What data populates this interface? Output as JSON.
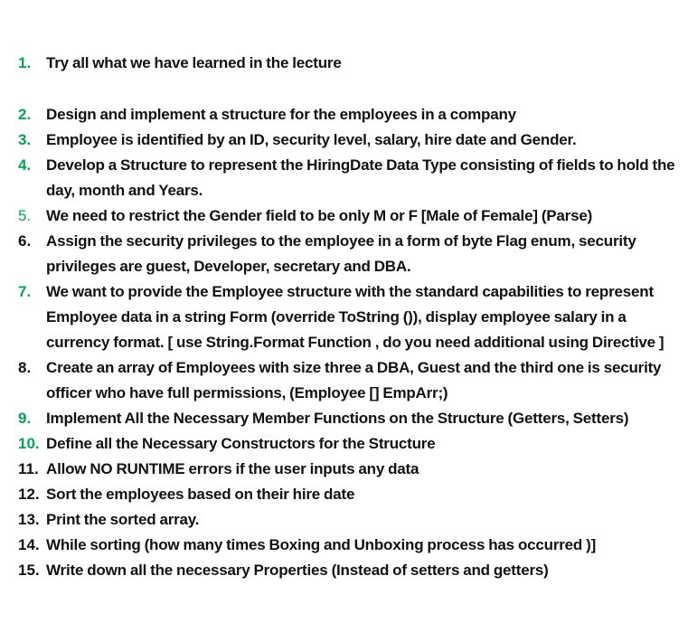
{
  "items": [
    {
      "number": "1.",
      "text": "Try all what we have learned in the lecture"
    },
    {
      "number": "2.",
      "text": "Design and implement a structure for the employees in a company"
    },
    {
      "number": "3.",
      "text": "Employee is identified by an ID, security level, salary, hire date and Gender."
    },
    {
      "number": "4.",
      "text": "Develop a Structure to represent the HiringDate Data Type consisting of fields to hold the day, month and Years."
    },
    {
      "number": "5.",
      "text": "We need to restrict the Gender field to be only M or F [Male of Female] (Parse)"
    },
    {
      "number": "6.",
      "text": "Assign the security privileges to the employee in a form of byte Flag enum, security privileges are guest, Developer, secretary and DBA."
    },
    {
      "number": "7.",
      "text": "We want to provide the Employee structure with the standard capabilities to represent Employee data in a string Form (override ToString ()), display employee salary in a currency format. [ use String.Format Function , do you need additional using Directive ]"
    },
    {
      "number": "8.",
      "text": "Create an array of Employees with size three a DBA, Guest and the third one is security officer who have full permissions, (Employee [] EmpArr;)"
    },
    {
      "number": "9.",
      "text": " Implement All the Necessary Member Functions on the Structure (Getters, Setters)"
    },
    {
      "number": "10.",
      "text": "Define all the Necessary Constructors for the Structure"
    },
    {
      "number": "11.",
      "text": "Allow NO RUNTIME errors if the user inputs any data"
    },
    {
      "number": "12.",
      "text": "Sort the employees based on their hire date"
    },
    {
      "number": "13.",
      "text": "Print the sorted array."
    },
    {
      "number": "14.",
      "text": "While sorting (how many times Boxing and Unboxing process has occurred )]"
    },
    {
      "number": "15.",
      "text": "Write down all the necessary Properties (Instead of setters and getters)"
    }
  ],
  "colors": {
    "accent_number": "#00a550",
    "text": "#111111",
    "background": "#ffffff"
  }
}
